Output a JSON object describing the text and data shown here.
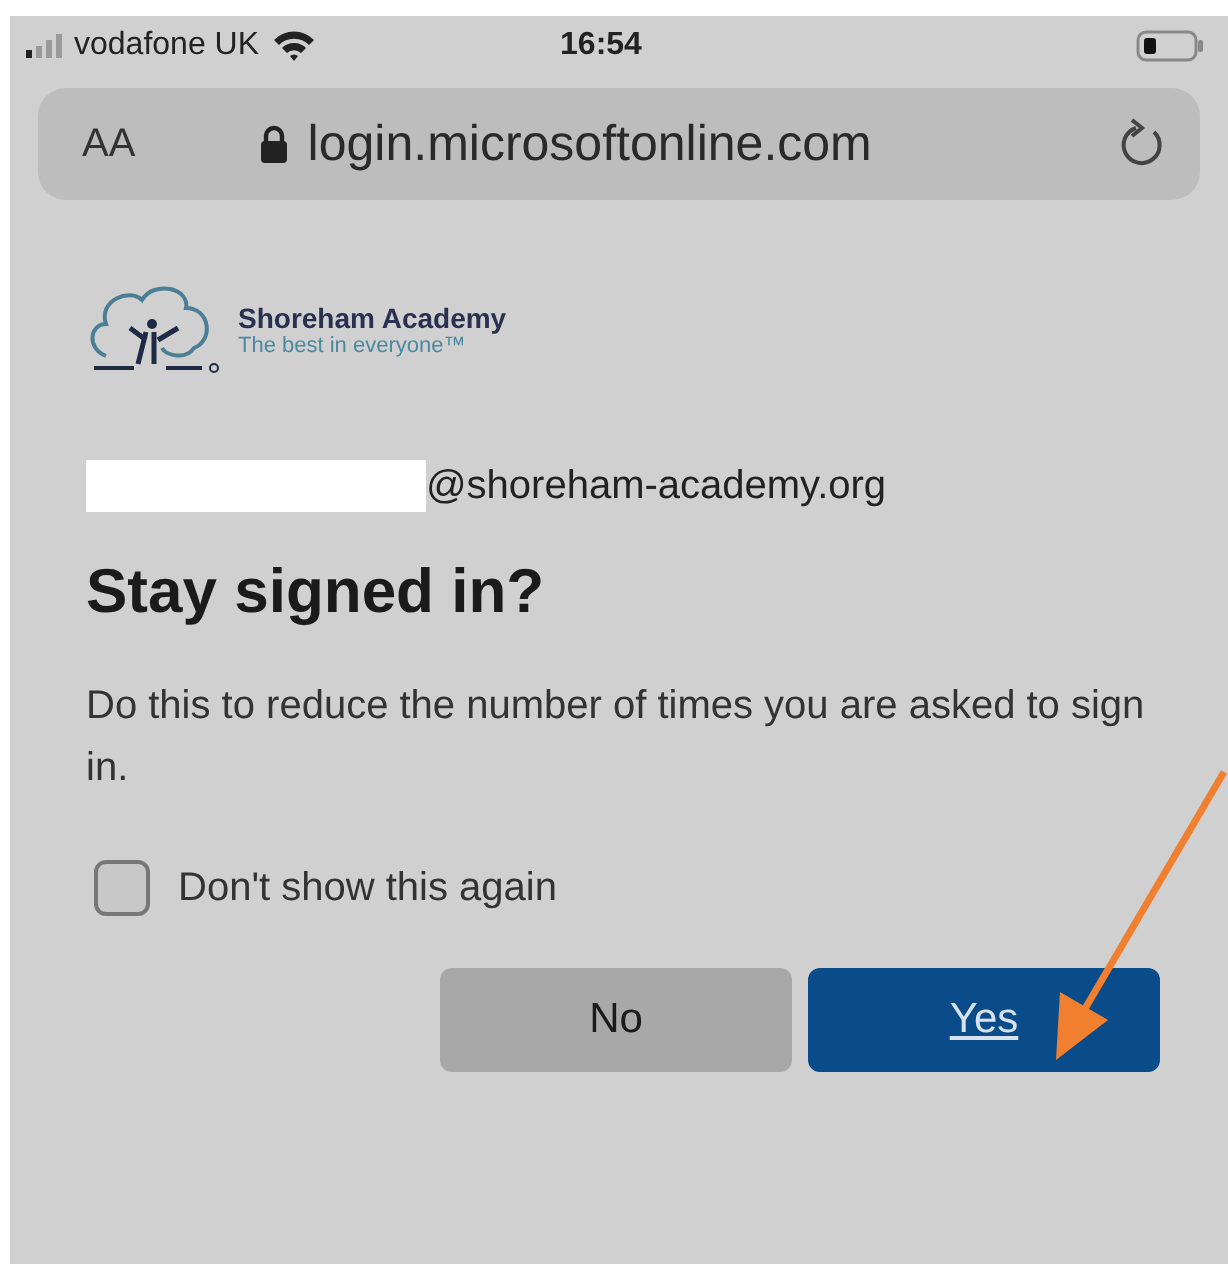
{
  "status_bar": {
    "carrier": "vodafone UK",
    "time": "16:54"
  },
  "address_bar": {
    "text_size": "AA",
    "url": "login.microsoftonline.com"
  },
  "logo": {
    "name": "Shoreham Academy",
    "tagline": "The best in everyone™"
  },
  "account": {
    "email": "@shoreham-academy.org"
  },
  "title": "Stay signed in?",
  "description": "Do this to reduce the number of times you are asked to sign in.",
  "checkbox": {
    "label": "Don't show this again",
    "checked": false
  },
  "buttons": [
    {
      "label": "No",
      "kind": "secondary"
    },
    {
      "label": "Yes",
      "kind": "primary"
    }
  ]
}
